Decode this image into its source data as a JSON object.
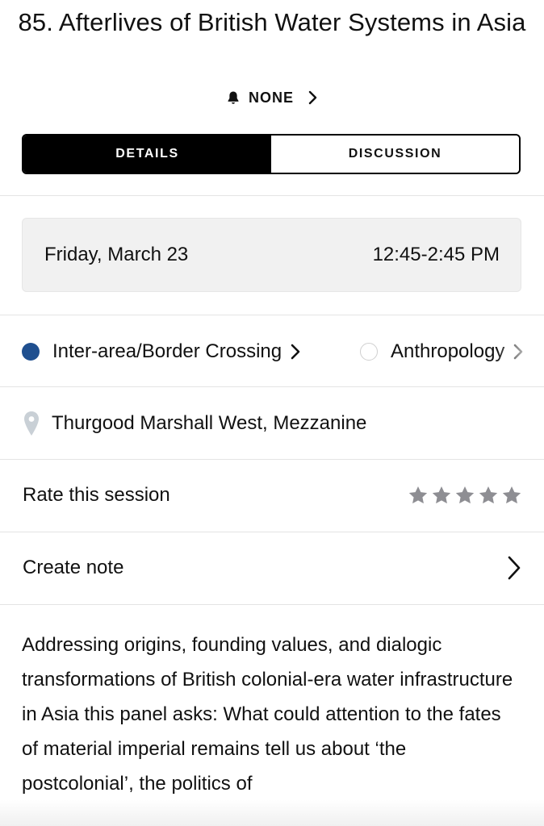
{
  "session": {
    "title": "85. Afterlives of British Water Systems in Asia",
    "notification_label": "NONE",
    "notification_icon": "bell-icon"
  },
  "tabs": [
    {
      "label": "DETAILS",
      "active": true
    },
    {
      "label": "DISCUSSION",
      "active": false
    }
  ],
  "schedule": {
    "date": "Friday, March 23",
    "time": "12:45-2:45 PM"
  },
  "tracks": [
    {
      "label": "Inter-area/Border Crossing",
      "color": "#1f4f8f"
    },
    {
      "label": "Anthropology",
      "color": "#ffffff"
    }
  ],
  "location": {
    "label": "Thurgood Marshall West, Mezzanine",
    "icon": "map-pin-icon"
  },
  "rating": {
    "label": "Rate this session",
    "stars_total": 5,
    "stars_filled": 0,
    "star_color": "#8e8e93"
  },
  "note": {
    "label": "Create note"
  },
  "description": "Addressing origins, founding values, and dialogic transformations of British colonial-era water infrastructure in Asia this panel asks: What could attention to the fates of material imperial remains tell us about ‘the postcolonial’, the politics of"
}
